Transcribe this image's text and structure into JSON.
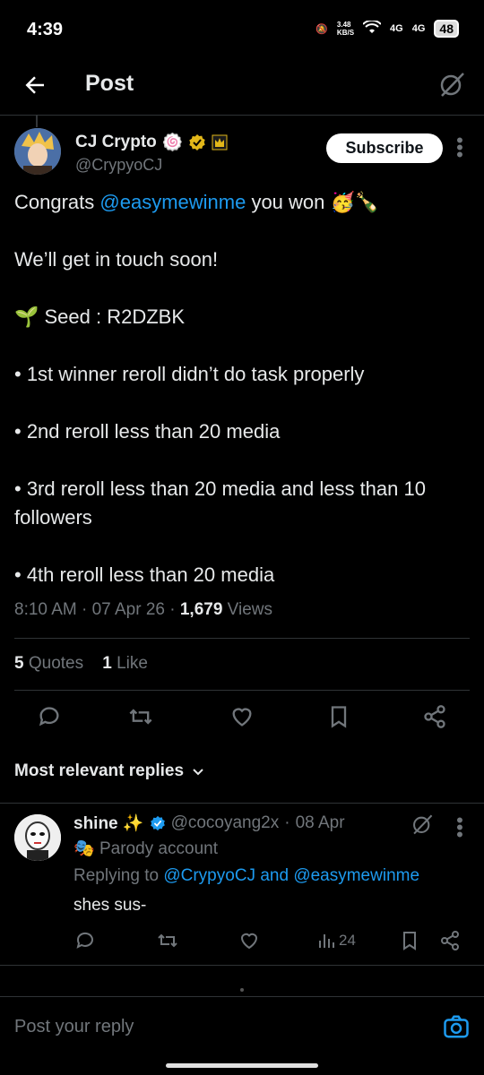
{
  "status_bar": {
    "time": "4:39",
    "speed": "3.48\nKB/S",
    "network1": "4G",
    "network2": "4G",
    "battery": "48"
  },
  "header": {
    "title": "Post"
  },
  "post": {
    "author_name": "CJ Crypto",
    "author_handle": "@CrypyoCJ",
    "subscribe_label": "Subscribe",
    "line1_pre": "Congrats ",
    "line1_mention": "@easymewinme",
    "line1_post": " you won 🥳🍾",
    "line2": "We’ll get in touch soon!",
    "line3": "🌱 Seed : R2DZBK",
    "line4": "• 1st winner reroll didn’t do task properly",
    "line5": "• 2nd reroll less than 20 media",
    "line6": "• 3rd reroll less than 20 media and less than 10 followers",
    "line7": "• 4th reroll less than 20 media",
    "time": "8:10 AM",
    "date": "07 Apr 26",
    "views_count": "1,679",
    "views_label": "Views",
    "quotes_count": "5",
    "quotes_label": "Quotes",
    "likes_count": "1",
    "likes_label": "Like"
  },
  "replies_section": {
    "title": "Most relevant replies"
  },
  "reply": {
    "name": "shine ✨",
    "handle": "@cocoyang2x",
    "date": "08 Apr",
    "parody": "Parody account",
    "replying_prefix": "Replying to ",
    "replying_user1": "@CrypyoCJ",
    "replying_and": " and ",
    "replying_user2": "@easymewinme",
    "text": "shes sus-",
    "views": "24"
  },
  "compose": {
    "placeholder": "Post your reply"
  },
  "colors": {
    "accent": "#1d9bf0",
    "background": "#000000",
    "muted": "#71767b",
    "verified_gold": "#e2b719"
  }
}
